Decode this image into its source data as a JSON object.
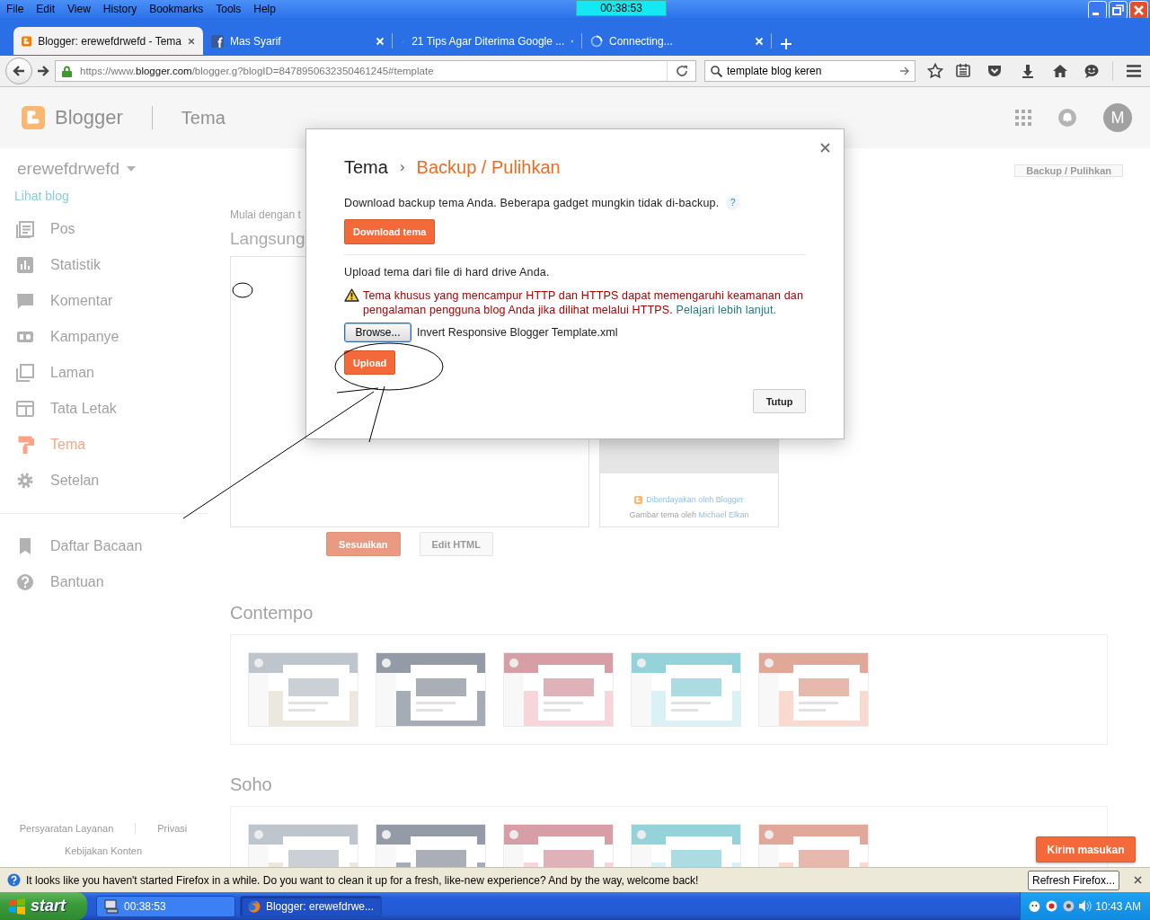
{
  "menu_bar": {
    "items": [
      "File",
      "Edit",
      "View",
      "History",
      "Bookmarks",
      "Tools",
      "Help"
    ],
    "timer": "00:38:53"
  },
  "tabs": [
    {
      "title": "Blogger: erewefdrwefd - Tema",
      "selected": true
    },
    {
      "title": "Mas Syarif",
      "selected": false
    },
    {
      "title": "21 Tips Agar Diterima Google ...",
      "selected": false
    },
    {
      "title": "Connecting...",
      "selected": false
    }
  ],
  "nav_bar": {
    "url": "https://www.**blogger.com**/blogger.g?blogID=8478950632350461245#template",
    "search": "template blog keren"
  },
  "header": {
    "brand": "Blogger",
    "section": "Tema",
    "avatar": "M"
  },
  "sidebar": {
    "blog_name": "erewefdrwefd",
    "view_link": "Lihat blog",
    "items": [
      {
        "label": "Pos",
        "selected": false
      },
      {
        "label": "Statistik",
        "selected": false
      },
      {
        "label": "Komentar",
        "selected": false
      },
      {
        "label": "Kampanye",
        "selected": false
      },
      {
        "label": "Laman",
        "selected": false
      },
      {
        "label": "Tata Letak",
        "selected": false
      },
      {
        "label": "Tema",
        "selected": true
      },
      {
        "label": "Setelan",
        "selected": false
      }
    ],
    "secondary_items": [
      {
        "label": "Daftar Bacaan"
      },
      {
        "label": "Bantuan"
      }
    ],
    "footer_links": [
      "Persyaratan Layanan",
      "Privasi",
      "Kebijakan Konten"
    ]
  },
  "content": {
    "backup_button": "Backup / Pulihkan",
    "intro": "Mulai dengan t",
    "current_heading": "Langsung",
    "credit": "Diberdayakan oleh Blogger",
    "image_credit": "Gambar tema oleh",
    "image_credit_link": "Michael Elkan",
    "buttons": [
      "Sesuaikan",
      "Edit HTML"
    ],
    "theme_groups": [
      {
        "title": "Contempo"
      },
      {
        "title": "Soho"
      }
    ],
    "feedback_button": "Kirim masukan"
  },
  "dialog": {
    "breadcrumb": "Tema",
    "separator": "›",
    "title": "Backup / Pulihkan",
    "download_text": "Download backup tema Anda. Beberapa gadget mungkin tidak di-backup.",
    "help": "?",
    "download_button": "Download tema",
    "upload_text": "Upload tema dari file di hard drive Anda.",
    "warning": "Tema khusus yang mencampur HTTP dan HTTPS dapat memengaruhi keamanan dan pengalaman pengguna blog Anda jika dilihat melalui HTTPS.",
    "warning_link": "Pelajari lebih lanjut.",
    "browse_button": "Browse...",
    "file_name": "Invert Responsive Blogger Template.xml",
    "upload_button": "Upload",
    "close_button": "Tutup"
  },
  "notification": {
    "message": "It looks like you haven't started Firefox in a while. Do you want to clean it up for a fresh, like-new experience? And by the way, welcome back!",
    "button": "Refresh Firefox..."
  },
  "taskbar": {
    "start": "start",
    "tasks": [
      {
        "title": "00:38:53",
        "selected": false
      },
      {
        "title": "Blogger: erewefdrwe...",
        "selected": true
      }
    ],
    "clock": "10:43 AM"
  }
}
